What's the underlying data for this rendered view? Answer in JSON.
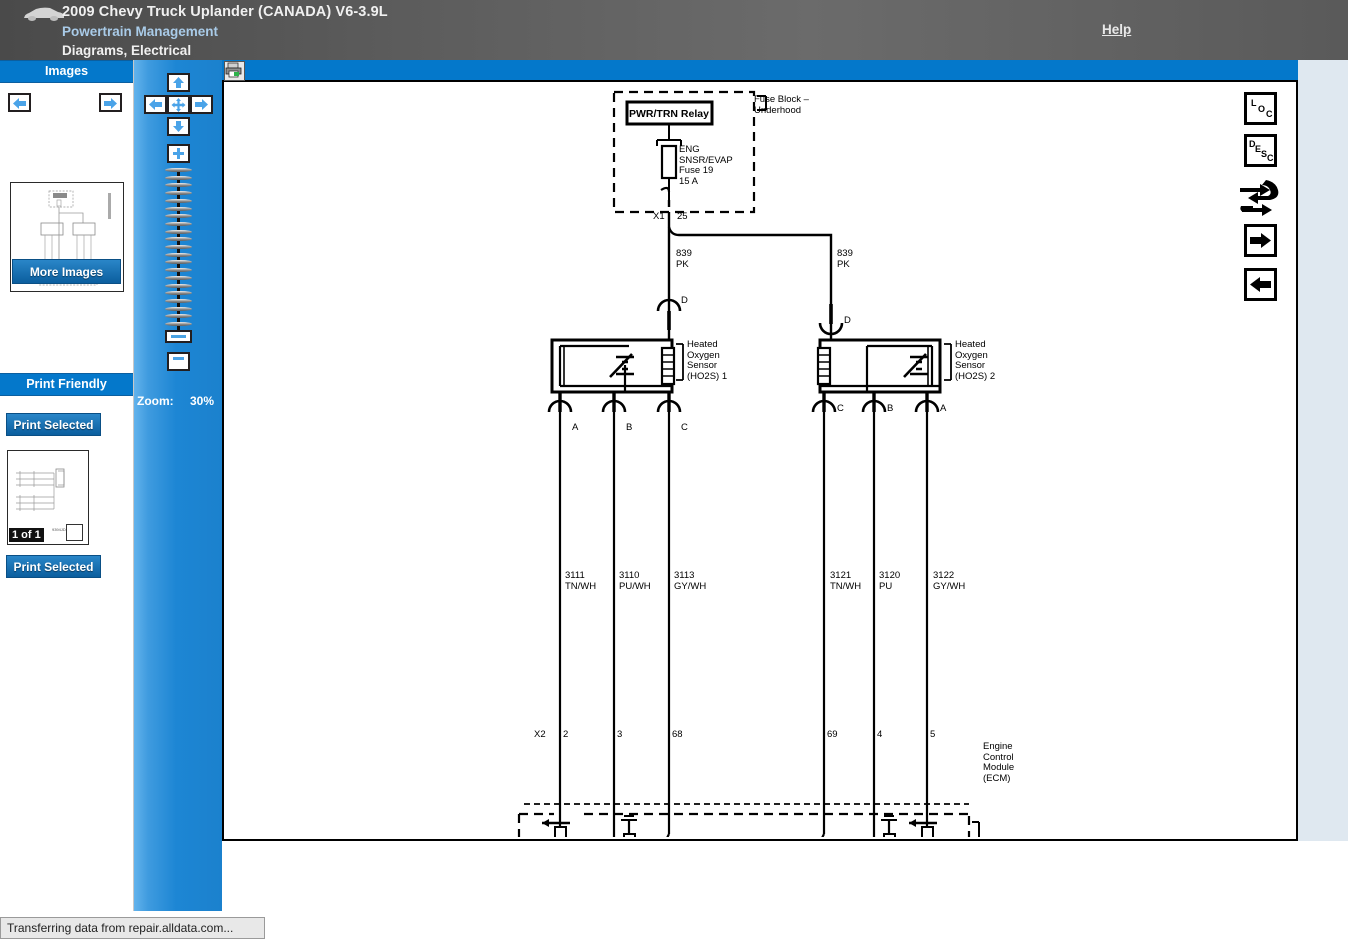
{
  "header": {
    "vehicle": "2009 Chevy Truck Uplander (CANADA) V6-3.9L",
    "section": "Powertrain Management",
    "subsection": "Diagrams, Electrical",
    "help_label": "Help",
    "car_icon": "car-icon",
    "bg_color": "#5c5c5c",
    "accent_color": "#0478cb"
  },
  "sidebar": {
    "images_header": "Images",
    "prev_icon": "left-arrow-icon",
    "next_icon": "right-arrow-icon",
    "more_images_label": "More Images",
    "print_friendly_header": "Print Friendly",
    "print_selected_top_label": "Print Selected",
    "print_selected_bottom_label": "Print Selected",
    "page_count_label": "1 of 1",
    "thumb_code": "9394JD2"
  },
  "zoom_panel": {
    "pan_up_icon": "up-arrow-icon",
    "pan_left_icon": "left-arrow-icon",
    "pan_center_icon": "move-icon",
    "pan_right_icon": "right-arrow-icon",
    "pan_down_icon": "down-arrow-icon",
    "zoom_in_icon": "plus-icon",
    "zoom_out_icon": "minus-icon",
    "slider_handle_icon": "slider-handle-icon",
    "zoom_label": "Zoom:",
    "zoom_value": "30%",
    "tick_count": 22
  },
  "viewer": {
    "print_icon": "printer-icon",
    "tools": [
      {
        "name": "tool-loc",
        "label": "LOC",
        "letters": [
          "L",
          "O",
          "C"
        ]
      },
      {
        "name": "tool-desc",
        "label": "DESC",
        "letters": [
          "D",
          "E",
          "S",
          "C"
        ]
      },
      {
        "name": "tool-swap",
        "label": "swap-tool-icon"
      },
      {
        "name": "tool-next",
        "label": "right-arrow-icon"
      },
      {
        "name": "tool-prev",
        "label": "left-arrow-icon"
      }
    ]
  },
  "schematic": {
    "fuse_block_label": "Fuse Block –\nUnderhood",
    "relay_label": "PWR/TRN Relay",
    "fuse_label": "ENG\nSNSR/EVAP\nFuse 19\n15 A",
    "connector_x1": "X1",
    "connector_x1_pin": "25",
    "wire_839_left": "839\nPK",
    "wire_839_right": "839\nPK",
    "splice_left": "D",
    "splice_right": "D",
    "ho2s1_label": "Heated\nOxygen\nSensor\n(HO2S) 1",
    "ho2s2_label": "Heated\nOxygen\nSensor\n(HO2S) 2",
    "ho2s1_pins": [
      "A",
      "B",
      "C"
    ],
    "ho2s2_pins": [
      "C",
      "B",
      "A"
    ],
    "wires": [
      {
        "id": "3111",
        "color": "TN/WH"
      },
      {
        "id": "3110",
        "color": "PU/WH"
      },
      {
        "id": "3113",
        "color": "GY/WH"
      },
      {
        "id": "3121",
        "color": "TN/WH"
      },
      {
        "id": "3120",
        "color": "PU"
      },
      {
        "id": "3122",
        "color": "GY/WH"
      }
    ],
    "ecm_connector": "X2",
    "ecm_pins": [
      "2",
      "3",
      "68",
      "69",
      "4",
      "5"
    ],
    "ecm_label": "Engine\nControl\nModule\n(ECM)"
  },
  "status": {
    "message": "Transferring data from repair.alldata.com..."
  }
}
